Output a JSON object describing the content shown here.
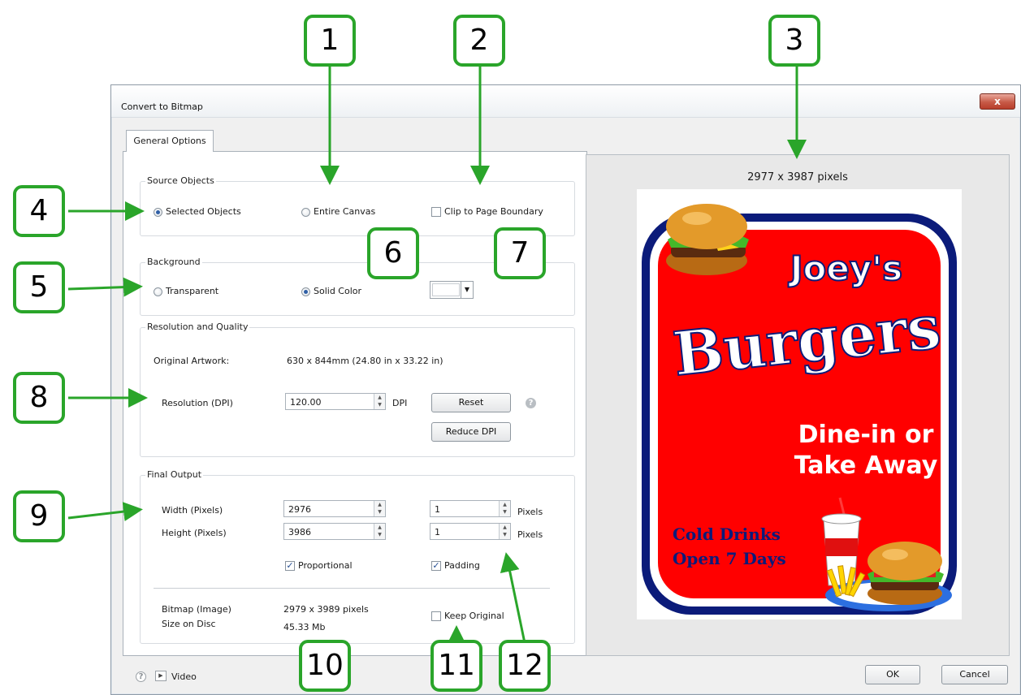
{
  "window": {
    "title": "Convert to Bitmap",
    "close_label": "x"
  },
  "tab": {
    "label": "General Options"
  },
  "source_objects": {
    "title": "Source Objects",
    "selected_objects": {
      "label": "Selected Objects",
      "checked": true
    },
    "entire_canvas": {
      "label": "Entire Canvas",
      "checked": false
    },
    "clip_to_page": {
      "label": "Clip to Page Boundary",
      "checked": false
    }
  },
  "background": {
    "title": "Background",
    "transparent": {
      "label": "Transparent",
      "checked": false
    },
    "solid_color": {
      "label": "Solid Color",
      "checked": true
    },
    "color_value": "#ffffff"
  },
  "resolution": {
    "title": "Resolution and Quality",
    "original_artwork_label": "Original Artwork:",
    "original_artwork_value": "630 x 844mm (24.80 in x 33.22 in)",
    "dpi_label": "Resolution (DPI)",
    "dpi_value": "120.00",
    "dpi_unit": "DPI",
    "reset_label": "Reset",
    "reduce_label": "Reduce DPI",
    "help_glyph": "?"
  },
  "final_output": {
    "title": "Final Output",
    "width_label": "Width (Pixels)",
    "width_value": "2976",
    "height_label": "Height (Pixels)",
    "height_value": "3986",
    "pad_w_value": "1",
    "pad_h_value": "1",
    "pad_unit_1": "Pixels",
    "pad_unit_2": "Pixels",
    "proportional_label": "Proportional",
    "proportional_checked": true,
    "padding_label": "Padding",
    "padding_checked": true,
    "bitmap_label": "Bitmap (Image)",
    "bitmap_value": "2979 x 3989 pixels",
    "size_label": "Size on Disc",
    "size_value": "45.33 Mb",
    "keep_original_label": "Keep Original",
    "keep_original_checked": false
  },
  "footer": {
    "help_glyph": "?",
    "video_label": "Video",
    "ok_label": "OK",
    "cancel_label": "Cancel"
  },
  "preview": {
    "pixel_size": "2977 x 3987 pixels",
    "sign": {
      "line1": "Joey's",
      "line2": "Burgers",
      "line3": "Dine-in or",
      "line4": "Take Away",
      "line5": "Cold Drinks",
      "line6": "Open 7 Days"
    }
  },
  "callouts": [
    "1",
    "2",
    "3",
    "4",
    "5",
    "6",
    "7",
    "8",
    "9",
    "10",
    "11",
    "12"
  ],
  "colors": {
    "callout_green": "#2aa52a",
    "sign_red": "#ff0000",
    "sign_navy": "#0b1b7a",
    "check_blue": "#254e93"
  }
}
